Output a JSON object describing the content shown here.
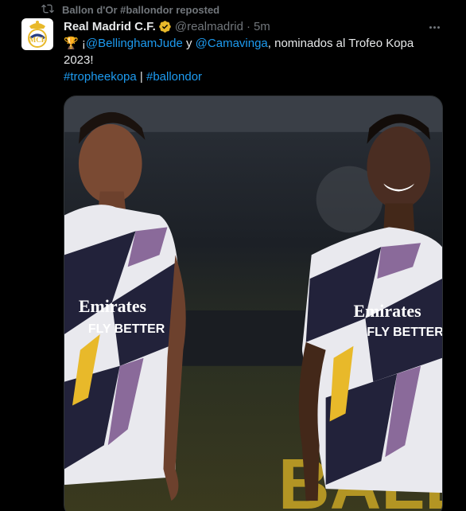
{
  "repost": {
    "text": "Ballon d'Or #ballondor reposted",
    "icon": "repost-icon"
  },
  "author": {
    "display_name": "Real Madrid C.F.",
    "handle": "@realmadrid",
    "separator": "·",
    "time": "5m",
    "verified_color": "#e8b92a"
  },
  "post": {
    "emoji": "🏆",
    "text_prefix": "¡",
    "mention1": "@BellinghamJude",
    "text_mid": " y ",
    "mention2": "@Camavinga",
    "text_suffix": ", nominados al Trofeo Kopa 2023!",
    "hashtag1": "#tropheekopa",
    "hashtag_sep": " | ",
    "hashtag2": "#ballondor"
  },
  "media": {
    "jersey_sponsor_top": "Emirates",
    "jersey_sponsor_bottom": "FLY BETTER",
    "background_text": "BALLA"
  },
  "colors": {
    "link": "#1d9bf0",
    "muted": "#71767b",
    "background": "#000000"
  }
}
